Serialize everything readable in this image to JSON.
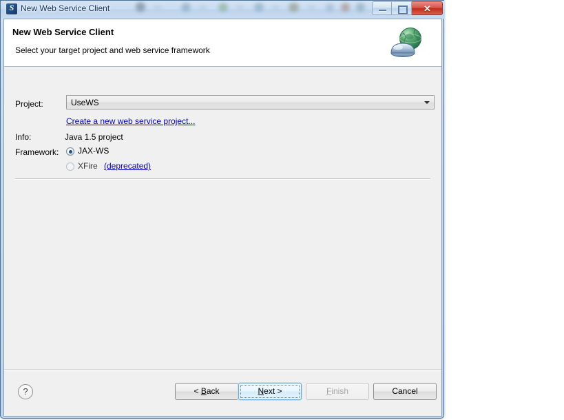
{
  "window": {
    "title": "New Web Service Client",
    "icon": "eclipse-wizard-icon",
    "icon_glyph": "S",
    "controls": {
      "minimize": "minimize-icon",
      "maximize": "maximize-icon",
      "close_label": "✕"
    }
  },
  "banner": {
    "title": "New Web Service Client",
    "subtitle": "Select your target project and web service framework",
    "icon": "web-service-globe-icon"
  },
  "form": {
    "project": {
      "label": "Project:",
      "value": "UseWS",
      "dropdown_icon": "chevron-down-icon"
    },
    "create_project_link": "Create a new web service project...",
    "info": {
      "label": "Info:",
      "value": "Java 1.5 project"
    },
    "framework": {
      "label": "Framework:",
      "options": [
        {
          "label": "JAX-WS",
          "selected": true,
          "suffix": ""
        },
        {
          "label": "XFire",
          "selected": false,
          "suffix": "(deprecated)"
        }
      ]
    }
  },
  "buttons": {
    "help": "?",
    "back": {
      "prefix": "< ",
      "mnemonic": "B",
      "rest": "ack",
      "enabled": true
    },
    "next": {
      "prefix": "",
      "mnemonic": "N",
      "rest": "ext >",
      "enabled": true,
      "default": true
    },
    "finish": {
      "prefix": "",
      "mnemonic": "F",
      "rest": "inish",
      "enabled": false
    },
    "cancel": {
      "prefix": "",
      "mnemonic": "",
      "rest": "Cancel",
      "enabled": true
    }
  },
  "colors": {
    "frame": "#4a6f96",
    "titlebar": "#c9dcf1",
    "client": "#f0f0f0",
    "banner": "#ffffff",
    "link": "#0000c8",
    "close_button": "#bf2c1d",
    "default_button_glow": "#6da9d4"
  }
}
